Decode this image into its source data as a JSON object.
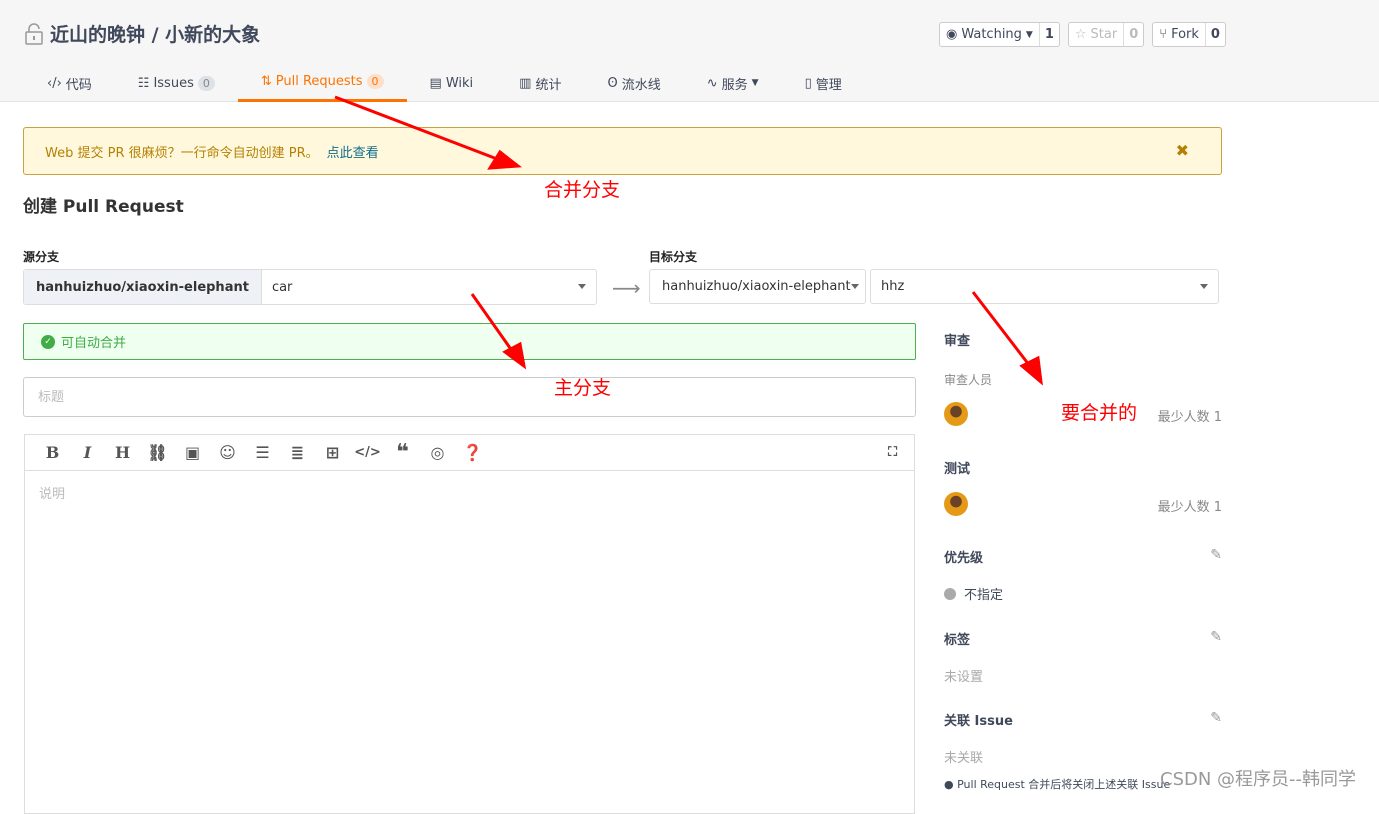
{
  "repo": {
    "title": "近山的晚钟 / 小新的大象",
    "icon": "lock-icon"
  },
  "repo_buttons": [
    {
      "label": "Watching",
      "count": "1",
      "icon": "eye-icon"
    },
    {
      "label": "Star",
      "count": "0",
      "icon": "star-icon"
    },
    {
      "label": "Fork",
      "count": "0",
      "icon": "fork-icon"
    }
  ],
  "tabs": [
    {
      "label": "代码",
      "icon": "code-icon"
    },
    {
      "label": "Issues",
      "badge": "0",
      "icon": "issues-icon"
    },
    {
      "label": "Pull Requests",
      "badge": "0",
      "icon": "pull-request-icon",
      "active": true
    },
    {
      "label": "Wiki",
      "icon": "book-icon"
    },
    {
      "label": "统计",
      "icon": "chart-icon"
    },
    {
      "label": "流水线",
      "icon": "pipeline-icon"
    },
    {
      "label": "服务",
      "icon": "pulse-icon"
    },
    {
      "label": "管理",
      "icon": "settings-icon"
    }
  ],
  "banner": {
    "text": "Web 提交 PR 很麻烦？一行命令自动创建 PR。",
    "link": "点此查看",
    "close": "✖"
  },
  "page_title": "创建 Pull Request",
  "source": {
    "label": "源分支",
    "repo": "hanhuizhuo/xiaoxin-elephant",
    "branch": "car"
  },
  "target": {
    "label": "目标分支",
    "repo": "hanhuizhuo/xiaoxin-elephant",
    "branch": "hhz"
  },
  "merge_status": "可自动合并",
  "title_placeholder": "标题",
  "desc_placeholder": "说明",
  "sidebar": {
    "review": {
      "title": "审查",
      "sub": "审查人员",
      "min": "最少人数 1"
    },
    "test": {
      "title": "测试",
      "min": "最少人数 1"
    },
    "priority": {
      "title": "优先级",
      "value": "不指定"
    },
    "labels": {
      "title": "标签",
      "value": "未设置"
    },
    "issue": {
      "title": "关联 Issue",
      "value": "未关联",
      "note": "Pull Request 合并后将关闭上述关联 Issue"
    }
  },
  "annotations": {
    "a1": "合并分支",
    "a2": "主分支",
    "a3": "要合并的"
  },
  "watermark": "CSDN @程序员--韩同学",
  "colors": {
    "accent": "#fe7300",
    "success": "#3fac46",
    "annotation": "#ff0000"
  }
}
